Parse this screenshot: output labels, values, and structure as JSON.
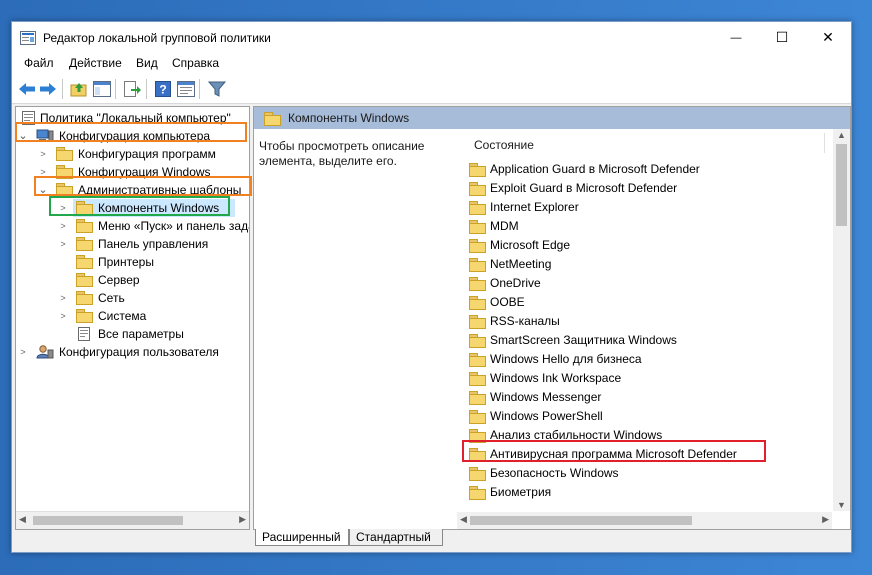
{
  "window": {
    "title": "Редактор локальной групповой политики",
    "controls": {
      "minimize": "—",
      "maximize": "☐",
      "close": "✕"
    }
  },
  "menu": [
    "Файл",
    "Действие",
    "Вид",
    "Справка"
  ],
  "toolbar": [
    "back-icon",
    "forward-icon",
    "up-folder-icon",
    "show-hide-tree-icon",
    "export-list-icon",
    "help-icon",
    "properties-icon",
    "filter-icon"
  ],
  "tree": {
    "root": "Политика \"Локальный компьютер\"",
    "computer_config": "Конфигурация компьютера",
    "software_config": "Конфигурация программ",
    "windows_config": "Конфигурация Windows",
    "admin_templates": "Административные шаблоны",
    "windows_components": "Компоненты Windows",
    "start_menu": "Меню «Пуск» и панель задач",
    "control_panel": "Панель управления",
    "printers": "Принтеры",
    "server": "Сервер",
    "network": "Сеть",
    "system": "Система",
    "all_settings": "Все параметры",
    "user_config": "Конфигурация пользователя"
  },
  "right": {
    "header": "Компоненты Windows",
    "description": "Чтобы просмотреть описание элемента, выделите его.",
    "column": "Состояние",
    "items": [
      "Application Guard в Microsoft Defender",
      "Exploit Guard в Microsoft Defender",
      "Internet Explorer",
      "MDM",
      "Microsoft Edge",
      "NetMeeting",
      "OneDrive",
      "OOBE",
      "RSS-каналы",
      "SmartScreen Защитника Windows",
      "Windows Hello для бизнеса",
      "Windows Ink Workspace",
      "Windows Messenger",
      "Windows PowerShell",
      "Анализ стабильности Windows",
      "Антивирусная программа Microsoft Defender",
      "Безопасность Windows",
      "Биометрия"
    ]
  },
  "tabs": {
    "extended": "Расширенный",
    "standard": "Стандартный"
  },
  "highlights": {
    "orange": "#f08020",
    "green": "#21a84a",
    "red": "#e0202a"
  }
}
